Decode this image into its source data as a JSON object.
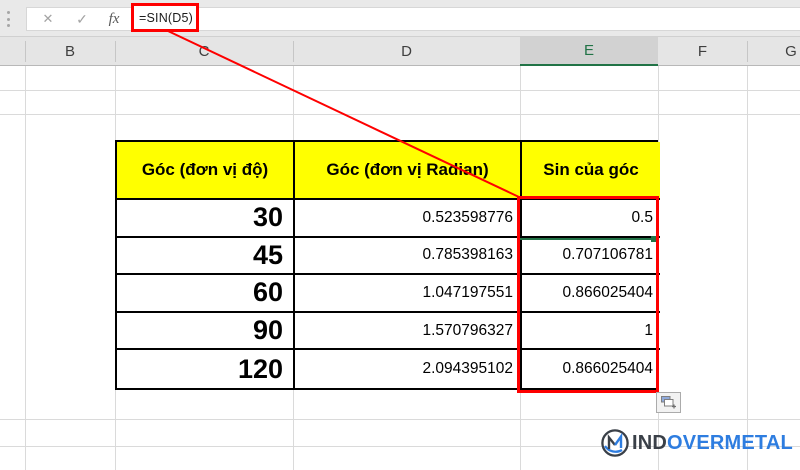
{
  "formula_bar": {
    "formula": "=SIN(D5)",
    "cancel_label": "✕",
    "enter_label": "✓",
    "function_label": "fx"
  },
  "columns": {
    "labels": [
      "B",
      "C",
      "D",
      "E",
      "F",
      "G"
    ],
    "selected": "E"
  },
  "table": {
    "headers": [
      "Góc (đơn vị độ)",
      "Góc (đơn vị Radian)",
      "Sin của góc"
    ],
    "rows": [
      [
        "30",
        "0.523598776",
        "0.5"
      ],
      [
        "45",
        "0.785398163",
        "0.707106781"
      ],
      [
        "60",
        "1.047197551",
        "0.866025404"
      ],
      [
        "90",
        "1.570796327",
        "1"
      ],
      [
        "120",
        "2.094395102",
        "0.866025404"
      ]
    ]
  },
  "annotations": {
    "highlight_color": "#fe0000",
    "selection_color": "#217346",
    "table_header_bg": "#ffff00"
  },
  "watermark": {
    "dark_text": "IND",
    "blue_text": "OVERMETAL",
    "dark_color": "#3a4048",
    "blue_color": "#2e7de0"
  }
}
